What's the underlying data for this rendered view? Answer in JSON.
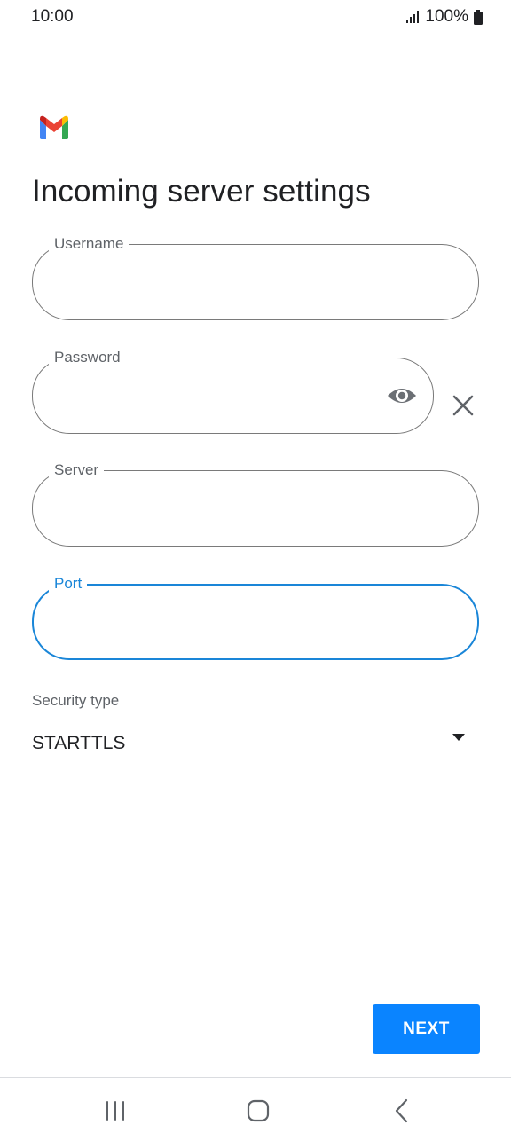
{
  "status_bar": {
    "time": "10:00",
    "battery": "100%"
  },
  "app": {
    "logo": "gmail-logo"
  },
  "page": {
    "title": "Incoming server settings"
  },
  "fields": {
    "username": {
      "label": "Username",
      "value": ""
    },
    "password": {
      "label": "Password",
      "value": "",
      "icon": "eye-icon"
    },
    "server": {
      "label": "Server",
      "value": ""
    },
    "port": {
      "label": "Port",
      "value": "",
      "focused": true
    }
  },
  "security": {
    "label": "Security type",
    "selected": "STARTTLS",
    "icon": "dropdown-arrow-icon"
  },
  "actions": {
    "next_label": "NEXT"
  },
  "colors": {
    "accent": "#1a86d8",
    "button": "#0a84ff",
    "outline": "#7a7a7a",
    "label": "#5f6368"
  },
  "nav_bar": {
    "icons": [
      "recents-icon",
      "home-icon",
      "back-icon"
    ]
  }
}
